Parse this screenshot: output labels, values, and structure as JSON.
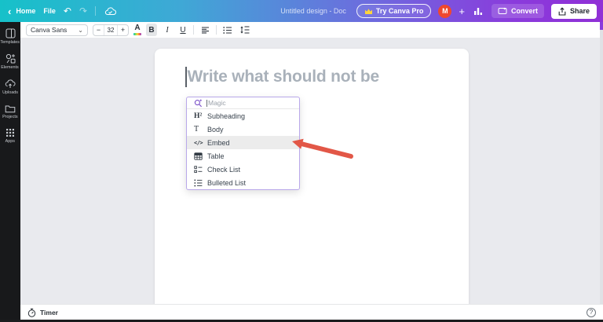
{
  "topbar": {
    "back_chevron": "‹",
    "home_label": "Home",
    "file_label": "File",
    "undo_glyph": "↶",
    "redo_glyph": "↷",
    "doc_title": "Untitled design - Doc",
    "try_pro_label": "Try Canva Pro",
    "avatar_initial": "M",
    "plus_glyph": "+",
    "convert_label": "Convert",
    "share_label": "Share"
  },
  "sidebar": {
    "items": [
      {
        "label": "Templates",
        "icon": "templates-icon"
      },
      {
        "label": "Elements",
        "icon": "elements-icon"
      },
      {
        "label": "Uploads",
        "icon": "uploads-icon"
      },
      {
        "label": "Projects",
        "icon": "projects-icon"
      },
      {
        "label": "Apps",
        "icon": "apps-icon"
      }
    ]
  },
  "toolbar": {
    "font_name": "Canva Sans",
    "font_chevron": "⌄",
    "size_minus": "−",
    "font_size": "32",
    "size_plus": "+",
    "color_letter": "A",
    "bold_label": "B",
    "italic_label": "I",
    "underline_label": "U"
  },
  "canvas": {
    "heading_placeholder": "Write what should not be"
  },
  "dropdown": {
    "search_placeholder": "Magic",
    "items": [
      {
        "label": "Subheading",
        "icon_glyph": "H²",
        "highlighted": false
      },
      {
        "label": "Body",
        "icon_glyph": "T",
        "highlighted": false
      },
      {
        "label": "Embed",
        "icon_glyph": "</>",
        "highlighted": true
      },
      {
        "label": "Table",
        "icon_glyph": "",
        "highlighted": false
      },
      {
        "label": "Check List",
        "icon_glyph": "",
        "highlighted": false
      },
      {
        "label": "Bulleted List",
        "icon_glyph": "",
        "highlighted": false
      }
    ]
  },
  "statusbar": {
    "timer_label": "Timer",
    "help_glyph": "?"
  },
  "colors": {
    "topbar_gradient_start": "#16c1c9",
    "topbar_gradient_end": "#8a3bdc",
    "sidebar_bg": "#18191b",
    "canvas_bg": "#e9eaee",
    "avatar_bg": "#f0482e",
    "highlight_row": "#ececec",
    "placeholder_text": "#a9b1ba",
    "annotation_arrow": "#e25747",
    "dropdown_border": "#b9a8ea"
  }
}
